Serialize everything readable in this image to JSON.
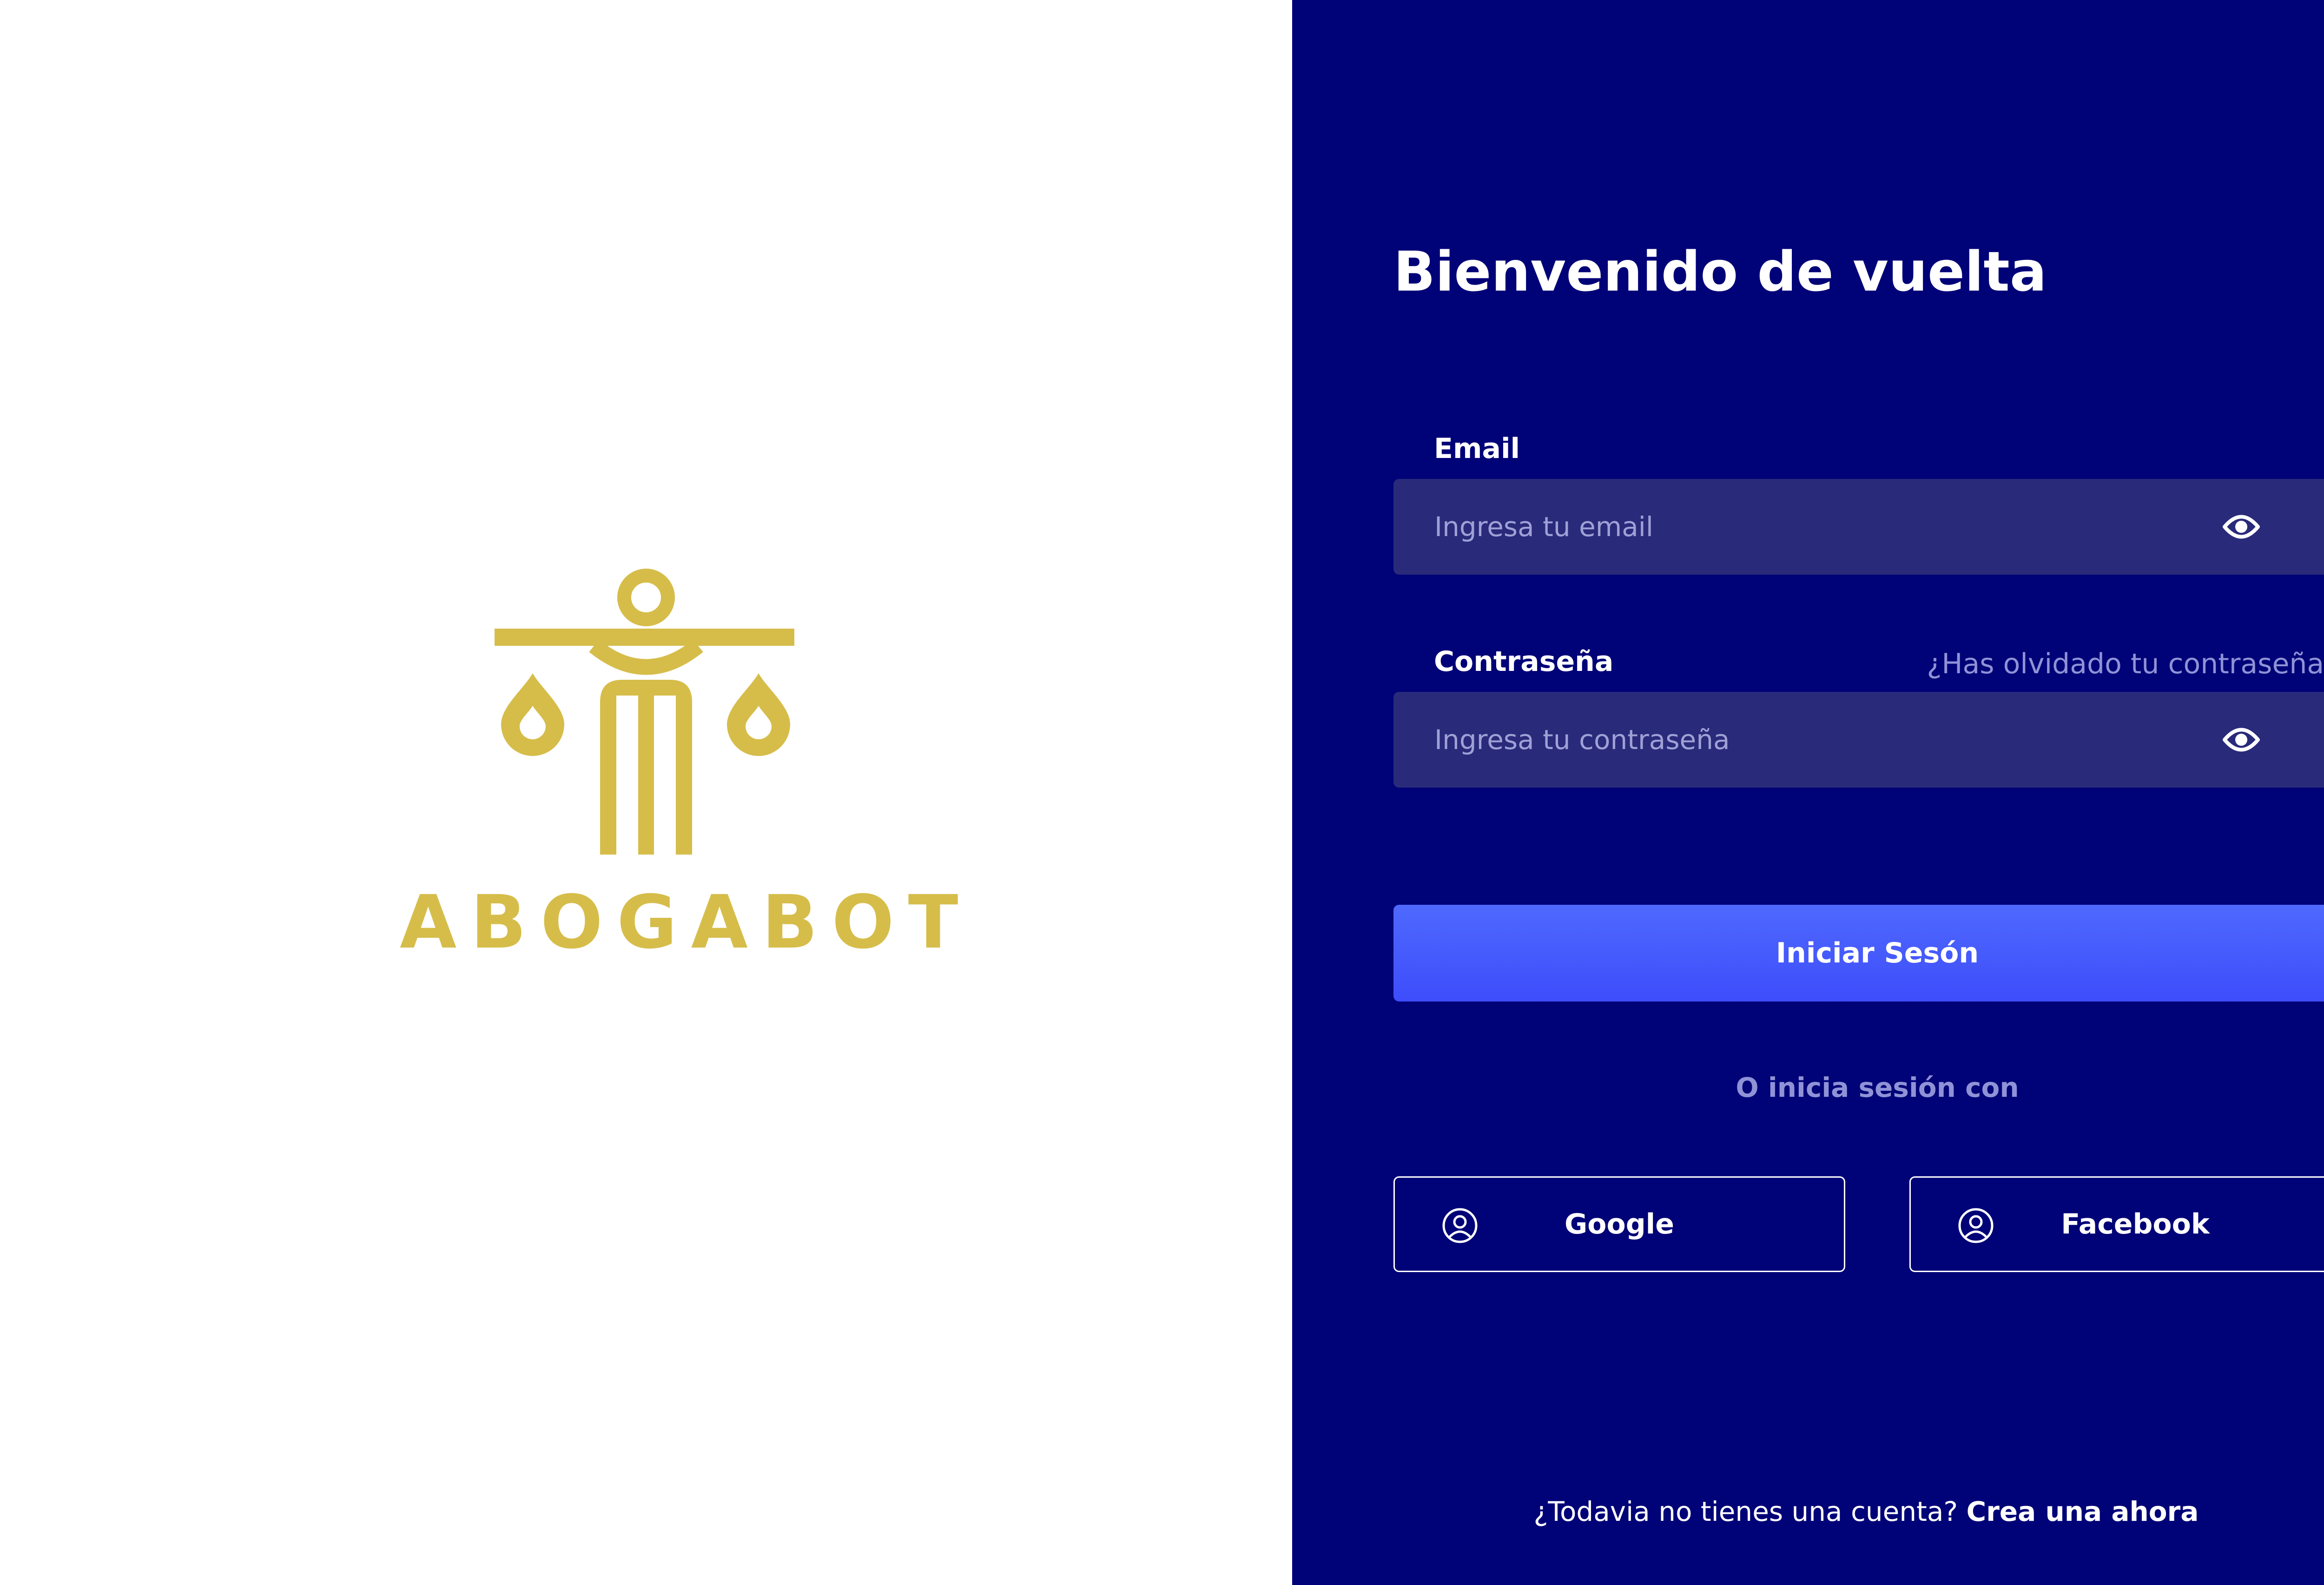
{
  "brand": {
    "name": "ABOGABOT",
    "logo_color": "#d6bd4a"
  },
  "theme": {
    "panel_bg": "#000277",
    "field_bg": "#292a7a",
    "primary_button": "#4556fc",
    "muted_text": "#8f92d6"
  },
  "login": {
    "title": "Bienvenido de vuelta",
    "email": {
      "label": "Email",
      "placeholder": "Ingresa tu email",
      "value": "",
      "icon": "eye-icon"
    },
    "password": {
      "label": "Contraseña",
      "placeholder": "Ingresa tu contraseña",
      "value": "",
      "icon": "eye-icon",
      "forgot_link": "¿Has olvidado tu contraseña?"
    },
    "submit_label": "Iniciar Sesón",
    "alt_login_text": "O inicia sesión con",
    "social": [
      {
        "label": "Google",
        "icon": "user-circle-icon"
      },
      {
        "label": "Facebook",
        "icon": "user-circle-icon"
      }
    ],
    "signup_prompt": "¿Todavia no tienes una cuenta?",
    "signup_link": "Crea una ahora"
  }
}
